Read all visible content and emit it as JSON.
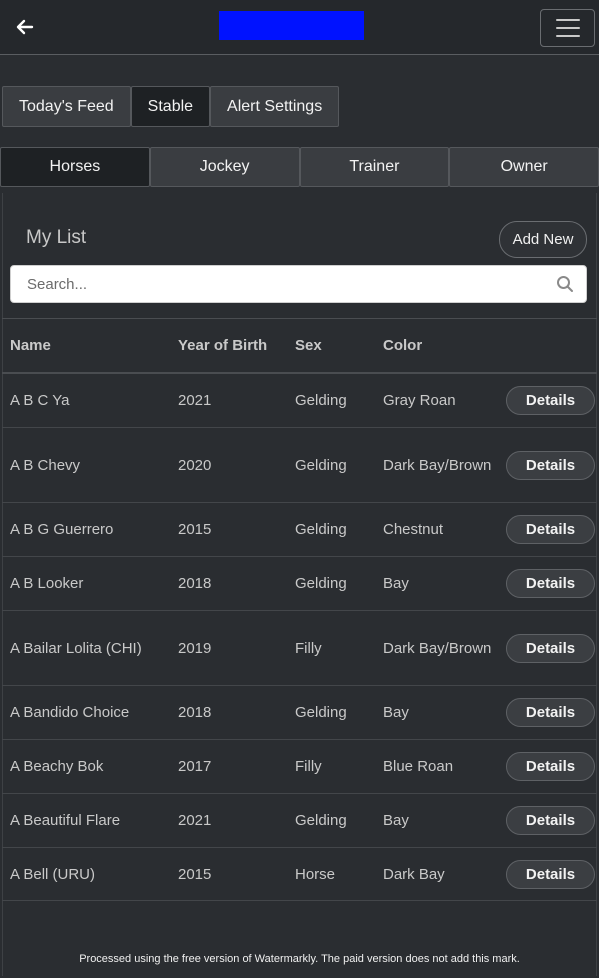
{
  "header": {
    "back_icon": "arrow-left-icon",
    "menu_icon": "hamburger-menu-icon",
    "logo_color": "#0012ff"
  },
  "tabs": [
    {
      "label": "Today's Feed",
      "active": false
    },
    {
      "label": "Stable",
      "active": true
    },
    {
      "label": "Alert Settings",
      "active": false
    }
  ],
  "subtabs": [
    {
      "label": "Horses",
      "active": true
    },
    {
      "label": "Jockey",
      "active": false
    },
    {
      "label": "Trainer",
      "active": false
    },
    {
      "label": "Owner",
      "active": false
    }
  ],
  "list": {
    "title": "My List",
    "add_button": "Add New",
    "search_placeholder": "Search..."
  },
  "table": {
    "headers": [
      "Name",
      "Year of Birth",
      "Sex",
      "Color"
    ],
    "details_label": "Details",
    "rows": [
      {
        "name": "A B C Ya",
        "year": "2021",
        "sex": "Gelding",
        "color": "Gray Roan"
      },
      {
        "name": "A B Chevy",
        "year": "2020",
        "sex": "Gelding",
        "color": "Dark Bay/Brown"
      },
      {
        "name": "A B G Guerrero",
        "year": "2015",
        "sex": "Gelding",
        "color": "Chestnut"
      },
      {
        "name": "A B Looker",
        "year": "2018",
        "sex": "Gelding",
        "color": "Bay"
      },
      {
        "name": "A Bailar Lolita (CHI)",
        "year": "2019",
        "sex": "Filly",
        "color": "Dark Bay/Brown"
      },
      {
        "name": "A Bandido Choice",
        "year": "2018",
        "sex": "Gelding",
        "color": "Bay"
      },
      {
        "name": "A Beachy Bok",
        "year": "2017",
        "sex": "Filly",
        "color": "Blue Roan"
      },
      {
        "name": "A Beautiful Flare",
        "year": "2021",
        "sex": "Gelding",
        "color": "Bay"
      },
      {
        "name": "A Bell (URU)",
        "year": "2015",
        "sex": "Horse",
        "color": "Dark Bay"
      }
    ]
  },
  "footer": {
    "watermark_note": "Processed using the free version of Watermarkly. The paid version does not add this mark."
  }
}
